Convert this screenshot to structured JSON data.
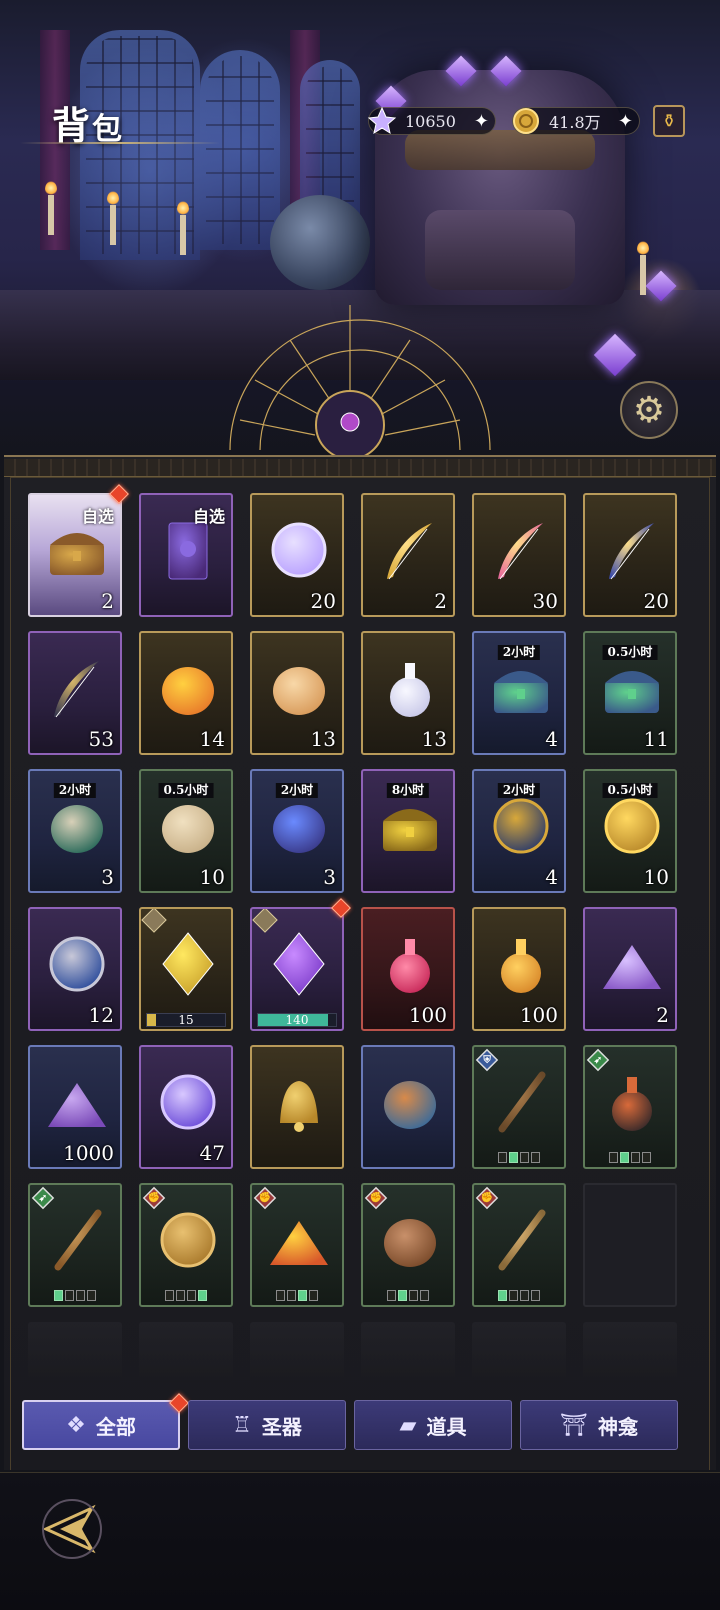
{
  "header": {
    "title_big": "背",
    "title_small": "包",
    "gems": "10650",
    "gold": "41.8万",
    "gem_icon": "star-crystal-icon",
    "gold_icon": "gold-coin-icon",
    "shop_icon": "potion-shop-icon",
    "settings_icon": "gear-icon"
  },
  "items": [
    {
      "tag": "自选",
      "count": "2",
      "rarity": "white-bg",
      "art": "mystery-chest-icon",
      "reddot": true
    },
    {
      "tag": "自选",
      "count": "",
      "rarity": "purple",
      "art": "tarot-card-icon"
    },
    {
      "count": "20",
      "rarity": "gold",
      "art": "crystal-ring-icon"
    },
    {
      "count": "2",
      "rarity": "gold",
      "art": "golden-feather-icon"
    },
    {
      "count": "30",
      "rarity": "gold",
      "art": "heart-feather-icon"
    },
    {
      "count": "20",
      "rarity": "gold",
      "art": "spade-feather-icon"
    },
    {
      "count": "53",
      "rarity": "purple",
      "art": "dark-feather-icon"
    },
    {
      "count": "14",
      "rarity": "gold",
      "art": "fireworks-icon"
    },
    {
      "count": "13",
      "rarity": "gold",
      "art": "conch-shell-icon"
    },
    {
      "count": "13",
      "rarity": "gold",
      "art": "perfume-bottle-icon"
    },
    {
      "time": "2小时",
      "count": "4",
      "rarity": "blue",
      "art": "upgrade-chest-icon"
    },
    {
      "time": "0.5小时",
      "count": "11",
      "rarity": "green",
      "art": "upgrade-chest-icon"
    },
    {
      "time": "2小时",
      "count": "3",
      "rarity": "blue",
      "art": "cloth-bag-icon"
    },
    {
      "time": "0.5小时",
      "count": "10",
      "rarity": "green",
      "art": "scroll-bundle-icon"
    },
    {
      "time": "2小时",
      "count": "3",
      "rarity": "blue",
      "art": "exp-bag-icon"
    },
    {
      "time": "8小时",
      "count": "",
      "rarity": "purple",
      "art": "treasure-chest-icon"
    },
    {
      "time": "2小时",
      "count": "4",
      "rarity": "blue",
      "art": "coin-bag-icon"
    },
    {
      "time": "0.5小时",
      "count": "10",
      "rarity": "green",
      "art": "gold-coins-icon"
    },
    {
      "count": "12",
      "rarity": "purple",
      "art": "rune-coin-icon"
    },
    {
      "bar": "15",
      "bar_fill": 0.12,
      "bar_color": "#d8b84a",
      "rarity": "gold",
      "art": "yellow-crystal-icon",
      "gem_badge": true
    },
    {
      "bar": "140",
      "bar_fill": 0.9,
      "bar_color": "#3fb89a",
      "rarity": "purple",
      "art": "purple-crystal-icon",
      "gem_badge": true,
      "reddot": true
    },
    {
      "count": "100",
      "rarity": "red",
      "art": "red-potion-icon"
    },
    {
      "count": "100",
      "rarity": "gold",
      "art": "orange-potion-icon"
    },
    {
      "count": "2",
      "rarity": "purple",
      "art": "amethyst-pile-icon"
    },
    {
      "count": "1000",
      "rarity": "blue",
      "art": "purple-dust-icon"
    },
    {
      "count": "47",
      "rarity": "purple",
      "art": "magic-orb-icon"
    },
    {
      "count": "",
      "rarity": "gold",
      "art": "golden-bell-icon"
    },
    {
      "count": "",
      "rarity": "blue",
      "art": "clay-pot-icon"
    },
    {
      "pips": [
        0,
        1,
        0,
        0
      ],
      "badge": "shield",
      "badge_color": "#3a5a9a",
      "rarity": "green",
      "art": "wooden-staff-icon"
    },
    {
      "pips": [
        0,
        1,
        0,
        0
      ],
      "badge": "boot",
      "badge_color": "#3a8a4a",
      "rarity": "green",
      "art": "dark-flask-icon"
    },
    {
      "pips": [
        1,
        0,
        0,
        0
      ],
      "badge": "boot",
      "badge_color": "#3a8a4a",
      "rarity": "green",
      "art": "arrowhead-icon"
    },
    {
      "pips": [
        0,
        0,
        0,
        1
      ],
      "badge": "fist",
      "badge_color": "#9a3a3a",
      "rarity": "green",
      "art": "medallion-icon"
    },
    {
      "pips": [
        0,
        0,
        1,
        0
      ],
      "badge": "fist",
      "badge_color": "#9a3a3a",
      "rarity": "green",
      "art": "campfire-icon"
    },
    {
      "pips": [
        0,
        1,
        0,
        0
      ],
      "badge": "fist",
      "badge_color": "#9a3a3a",
      "rarity": "green",
      "art": "ancient-urn-icon"
    },
    {
      "pips": [
        1,
        0,
        0,
        0
      ],
      "badge": "fist",
      "badge_color": "#9a3a3a",
      "rarity": "green",
      "art": "bronze-sword-icon"
    },
    {
      "empty": true
    }
  ],
  "tabs": [
    {
      "label": "全部",
      "icon": "grid-icon",
      "active": true,
      "reddot": true
    },
    {
      "label": "圣器",
      "icon": "chalice-icon",
      "active": false
    },
    {
      "label": "道具",
      "icon": "ingot-icon",
      "active": false
    },
    {
      "label": "神龛",
      "icon": "shrine-icon",
      "active": false
    }
  ],
  "footer": {
    "back_icon": "back-arrow-icon"
  }
}
